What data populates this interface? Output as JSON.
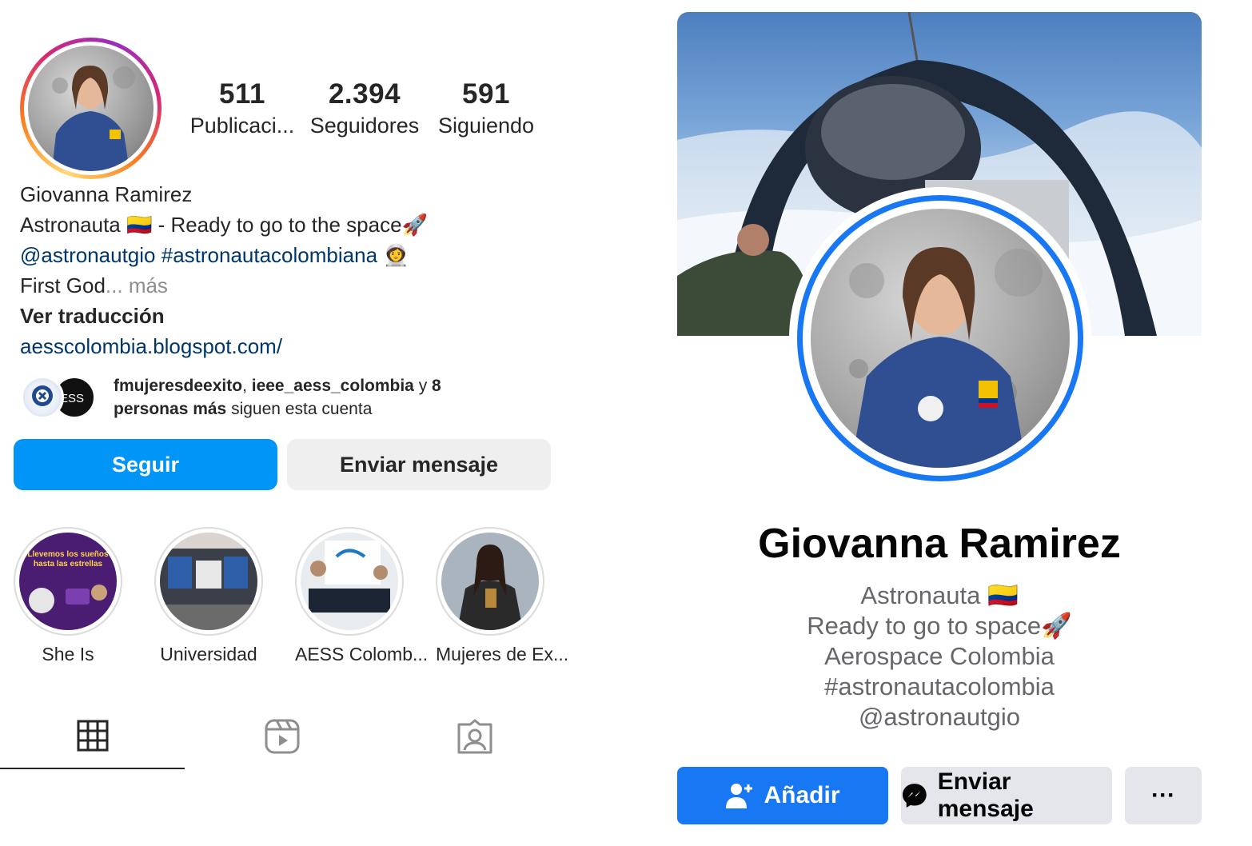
{
  "instagram": {
    "stats": [
      {
        "value": "511",
        "label": "Publicaci..."
      },
      {
        "value": "2.394",
        "label": "Seguidores"
      },
      {
        "value": "591",
        "label": "Siguiendo"
      }
    ],
    "name": "Giovanna Ramirez",
    "bio_line1": "Astronauta 🇨🇴 - Ready to go to the space🚀",
    "bio_mention": "@astronautgio",
    "bio_hashtag": "#astronautacolombiana",
    "bio_emoji": "👩‍🚀",
    "bio_line3": "First God",
    "bio_more": "... más",
    "translate": "Ver traducción",
    "link": "aesscolombia.blogspot.com/",
    "followed_by": {
      "user1": "fmujeresdeexito",
      "sep": ", ",
      "user2": "ieee_aess_colombia",
      "and": " y ",
      "count": "8",
      "others": "personas más",
      "suffix": " siguen esta cuenta"
    },
    "follow_button": "Seguir",
    "message_button": "Enviar mensaje",
    "highlights": [
      {
        "label": "She Is",
        "text1": "Llevemos los sueños",
        "text2": "hasta las estrellas"
      },
      {
        "label": "Universidad"
      },
      {
        "label": "AESS Colomb..."
      },
      {
        "label": "Mujeres de Ex..."
      }
    ],
    "tabs": [
      "grid-icon",
      "reels-icon",
      "tagged-icon"
    ]
  },
  "facebook": {
    "name": "Giovanna Ramirez",
    "bio": [
      "Astronauta 🇨🇴",
      "Ready to go to space🚀",
      "Aerospace Colombia",
      "#astronautacolombia",
      "@astronautgio"
    ],
    "add_button": "Añadir",
    "message_button": "Enviar mensaje",
    "more_button": "···",
    "colors": {
      "primary": "#1877f2",
      "secondary": "#e4e6eb"
    }
  },
  "colors": {
    "ig_blue": "#0095f6",
    "ig_link": "#00376b"
  }
}
